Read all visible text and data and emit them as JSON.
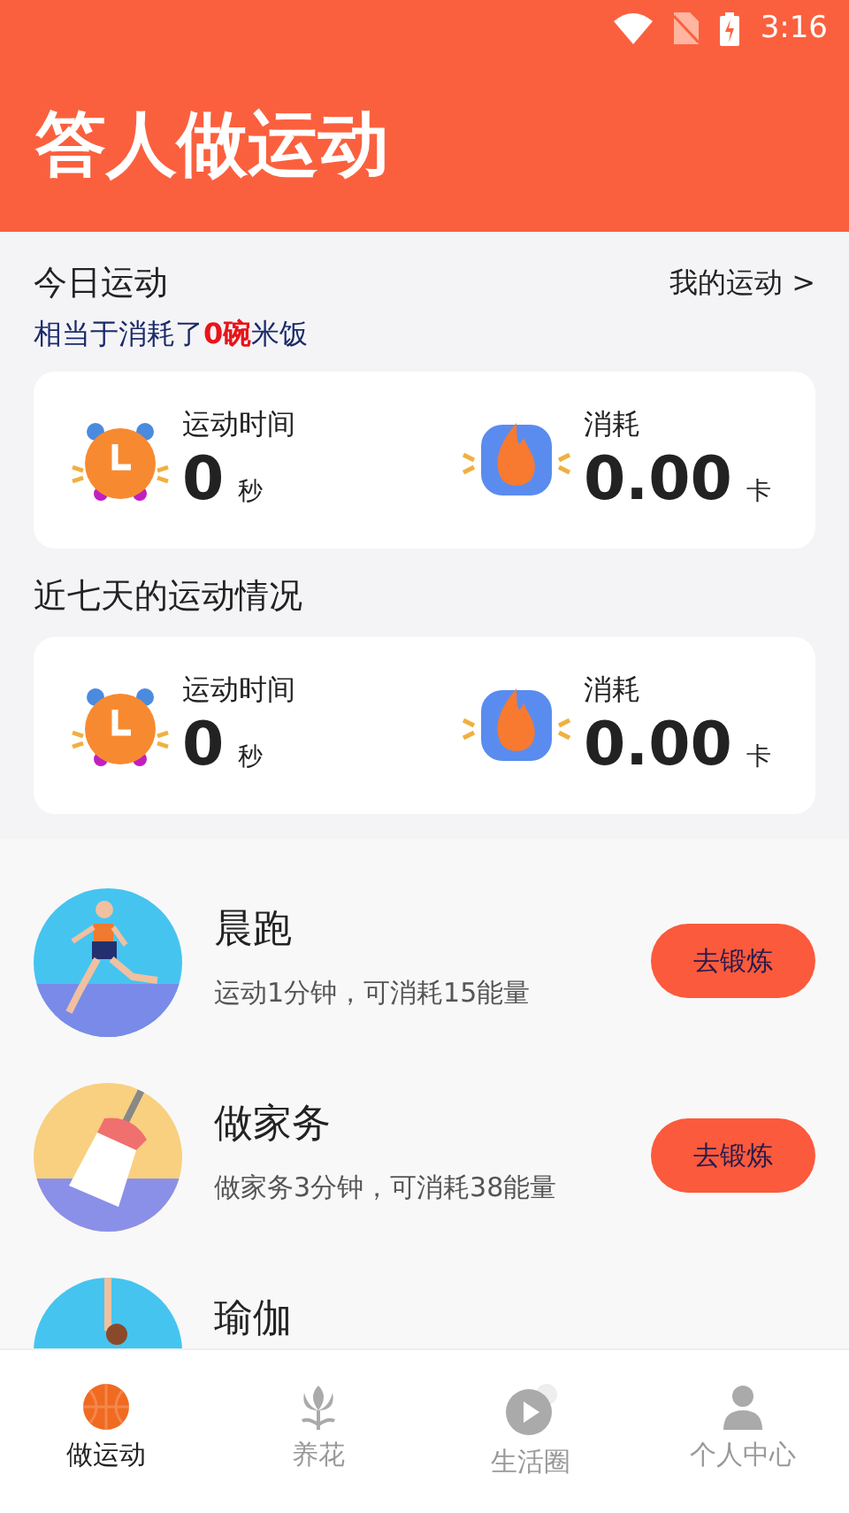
{
  "status_bar": {
    "time": "3:16"
  },
  "header": {
    "title": "答人做运动"
  },
  "today": {
    "title": "今日运动",
    "link": "我的运动 >",
    "summary": "相当于消耗了**0碗**米饭",
    "stats": [
      {
        "kind": "time",
        "label": "运动时间",
        "value": "0",
        "unit": "秒"
      },
      {
        "kind": "calories",
        "label": "消耗",
        "value": "0.00",
        "unit": "卡"
      }
    ]
  },
  "week": {
    "title": "近七天的运动情况",
    "stats": [
      {
        "kind": "time",
        "label": "运动时间",
        "value": "0",
        "unit": "秒"
      },
      {
        "kind": "calories",
        "label": "消耗",
        "value": "0.00",
        "unit": "卡"
      }
    ]
  },
  "activities": [
    {
      "kind": "running",
      "name": "晨跑",
      "description": "运动1分钟，可消耗15能量",
      "button": "去锻炼"
    },
    {
      "kind": "housework",
      "name": "做家务",
      "description": "做家务3分钟，可消耗38能量",
      "button": "去锻炼"
    },
    {
      "kind": "yoga",
      "name": "瑜伽"
    }
  ],
  "tabs": [
    {
      "kind": "sport",
      "label": "做运动",
      "selected": true
    },
    {
      "kind": "flower",
      "label": "养花",
      "selected": false
    },
    {
      "kind": "video",
      "label": "生活圈",
      "selected": false
    },
    {
      "kind": "person",
      "label": "个人中心",
      "selected": false
    }
  ]
}
